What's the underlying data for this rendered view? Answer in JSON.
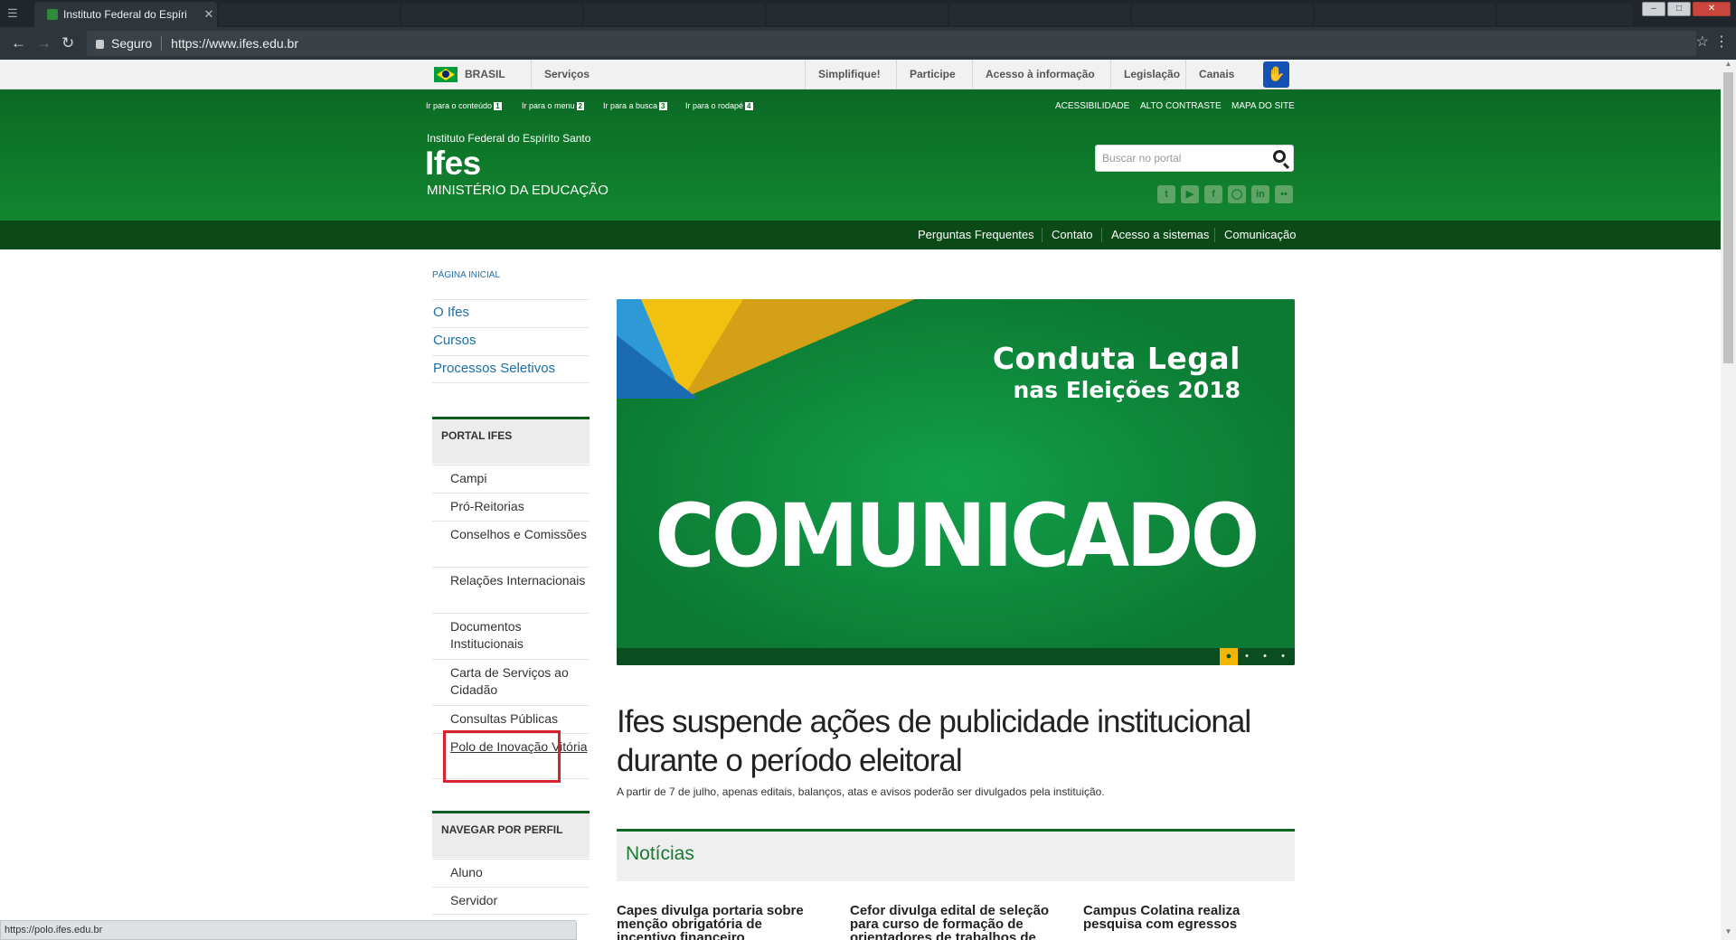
{
  "browser": {
    "active_tab_title": "Instituto Federal do Espíri",
    "url_security_label": "Seguro",
    "url": "https://www.ifes.edu.br"
  },
  "govbar": {
    "country": "BRASIL",
    "items": [
      "Serviços",
      "Simplifique!",
      "Participe",
      "Acesso à informação",
      "Legislação",
      "Canais"
    ]
  },
  "header": {
    "skip_links": [
      {
        "label": "Ir para o conteúdo",
        "key": "1"
      },
      {
        "label": "Ir para o menu",
        "key": "2"
      },
      {
        "label": "Ir para a busca",
        "key": "3"
      },
      {
        "label": "Ir para o rodapé",
        "key": "4"
      }
    ],
    "utility_links": [
      "ACESSIBILIDADE",
      "ALTO CONTRASTE",
      "MAPA DO SITE"
    ],
    "institution": "Instituto Federal do Espírito Santo",
    "site_name": "Ifes",
    "ministry": "MINISTÉRIO DA EDUCAÇÃO",
    "search_placeholder": "Buscar no portal",
    "social_icons": [
      "twitter-icon",
      "youtube-icon",
      "facebook-icon",
      "instagram-icon",
      "linkedin-icon",
      "flickr-icon"
    ]
  },
  "subnav": [
    "Perguntas Frequentes",
    "Contato",
    "Acesso a sistemas",
    "Comunicação"
  ],
  "sidebar": {
    "breadcrumb": "PÁGINA INICIAL",
    "top_links": [
      "O Ifes",
      "Cursos",
      "Processos Seletivos"
    ],
    "portal_title": "PORTAL IFES",
    "portal_items": [
      "Campi",
      "Pró-Reitorias",
      "Conselhos e Comissões",
      "Relações Internacionais",
      "Documentos Institucionais",
      "Carta de Serviços ao Cidadão",
      "Consultas Públicas",
      "Polo de Inovação Vitória"
    ],
    "profile_title": "NAVEGAR POR PERFIL",
    "profile_items": [
      "Aluno",
      "Servidor"
    ]
  },
  "banner": {
    "line1": "Conduta Legal",
    "line2": "nas Eleições 2018",
    "main": "COMUNICADO",
    "active_slide": 1,
    "slide_count": 4
  },
  "headline": "Ifes suspende ações de publicidade institucional durante o período eleitoral",
  "subtitle": "A partir de 7 de julho, apenas editais, balanços, atas e avisos poderão ser divulgados pela instituição.",
  "news": {
    "section_title": "Notícias",
    "items": [
      "Capes divulga portaria sobre menção obrigatória de incentivo financeiro",
      "Cefor divulga edital de seleção para curso de formação de orientadores de trabalhos de",
      "Campus Colatina realiza pesquisa com egressos"
    ]
  },
  "status_url": "https://polo.ifes.edu.br",
  "colors": {
    "header_green": "#0f7a2b",
    "subnav_green": "#0b4a17",
    "link_blue": "#1a6fa8",
    "highlight_red": "#d7232f",
    "slide_active": "#f2b705"
  }
}
